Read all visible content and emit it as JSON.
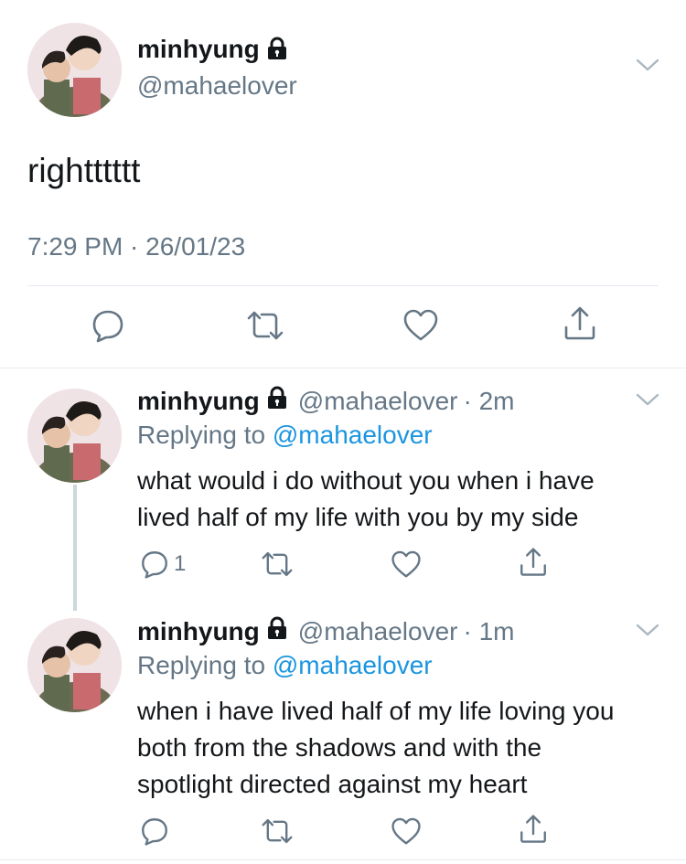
{
  "main_tweet": {
    "author_name": "minhyung",
    "author_handle": "@mahaelover",
    "text": "rightttttt",
    "timestamp": "7:29 PM · 26/01/23"
  },
  "replies": [
    {
      "author_name": "minhyung",
      "author_handle": "@mahaelover",
      "time": "· 2m",
      "replying_label": "Replying to",
      "replying_to": "@mahaelover",
      "text_lines": [
        "what would i do without you when i have",
        "lived half of my life with you by my side"
      ],
      "reply_count": "1"
    },
    {
      "author_name": "minhyung",
      "author_handle": "@mahaelover",
      "time": "· 1m",
      "replying_label": "Replying to",
      "replying_to": "@mahaelover",
      "text_lines": [
        "when i have lived half of my life loving you",
        "both from the shadows and with the",
        "spotlight directed against my heart"
      ],
      "reply_count": ""
    }
  ],
  "colors": {
    "link": "#1b95e0",
    "muted": "#657786",
    "divider": "#e6ecf0",
    "thread_line": "#ccd6dd"
  },
  "icons": [
    "lock-icon",
    "chevron-down-icon",
    "reply-icon",
    "retweet-icon",
    "like-icon",
    "share-icon"
  ]
}
